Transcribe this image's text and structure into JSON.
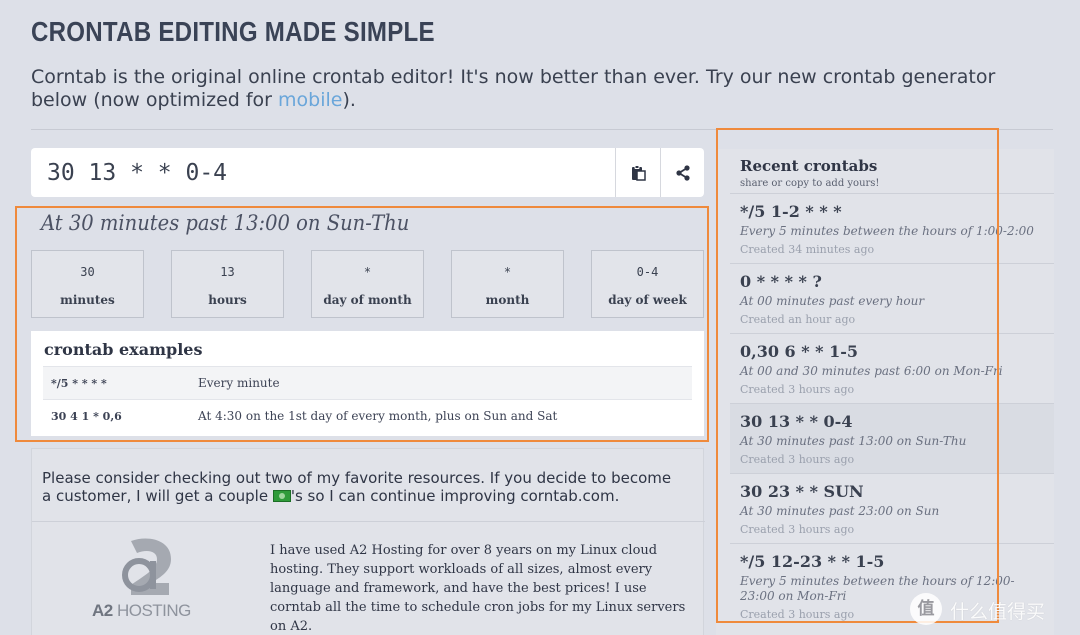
{
  "header": {
    "title": "CRONTAB EDITING MADE SIMPLE",
    "intro_before": "Corntab is the original online crontab editor! It's now better than ever. Try our new crontab generator below (now optimized for ",
    "intro_link": "mobile",
    "intro_after": ")."
  },
  "editor": {
    "expression": "30 13 * * 0-4",
    "copy_icon": "clipboard-icon",
    "share_icon": "share-icon"
  },
  "description": "At 30 minutes past 13:00 on Sun-Thu",
  "fields": [
    {
      "value": "30",
      "label": "minutes"
    },
    {
      "value": "13",
      "label": "hours"
    },
    {
      "value": "*",
      "label": "day of month"
    },
    {
      "value": "*",
      "label": "month"
    },
    {
      "value": "0-4",
      "label": "day of week"
    }
  ],
  "examples": {
    "title": "crontab examples",
    "rows": [
      {
        "expr": "*/5 * * * *",
        "desc": "Every minute"
      },
      {
        "expr": "30 4 1 * 0,6",
        "desc": "At 4:30 on the 1st day of every month, plus on Sun and Sat"
      }
    ]
  },
  "resources": {
    "message_before": "Please consider checking out two of my favorite resources. If you decide to become a customer, I will get a couple ",
    "message_after": "'s so I can continue improving corntab.com.",
    "logo_mark": "a2",
    "logo_text_bold": "A2",
    "logo_text": " HOSTING",
    "a2_text": "I have used A2 Hosting for over 8 years on my Linux cloud hosting. They support workloads of all sizes, almost every language and framework, and have the best prices! I use corntab all the time to schedule cron jobs for my Linux servers on A2."
  },
  "recent": {
    "title": "Recent crontabs",
    "subtitle": "share or copy to add yours!",
    "items": [
      {
        "cron": "*/5 1-2 * * *",
        "desc": "Every 5 minutes between the hours of 1:00-2:00",
        "time": "Created 34 minutes ago"
      },
      {
        "cron": "0 * * * * ?",
        "desc": "At 00 minutes past every hour",
        "time": "Created an hour ago"
      },
      {
        "cron": "0,30 6 * * 1-5",
        "desc": "At 00 and 30 minutes past 6:00 on Mon-Fri",
        "time": "Created 3 hours ago"
      },
      {
        "cron": "30 13 * * 0-4",
        "desc": "At 30 minutes past 13:00 on Sun-Thu",
        "time": "Created 3 hours ago"
      },
      {
        "cron": "30 23 * * SUN",
        "desc": "At 30 minutes past 23:00 on Sun",
        "time": "Created 3 hours ago"
      },
      {
        "cron": "*/5 12-23 * * 1-5",
        "desc": "Every 5 minutes between the hours of 12:00-23:00 on Mon-Fri",
        "time": "Created 3 hours ago"
      }
    ]
  },
  "watermark": {
    "mark": "值",
    "text": "什么值得买"
  },
  "colors": {
    "accent_orange": "#ef8a3c",
    "link_blue": "#6aa6da",
    "background": "#dde0e8"
  }
}
